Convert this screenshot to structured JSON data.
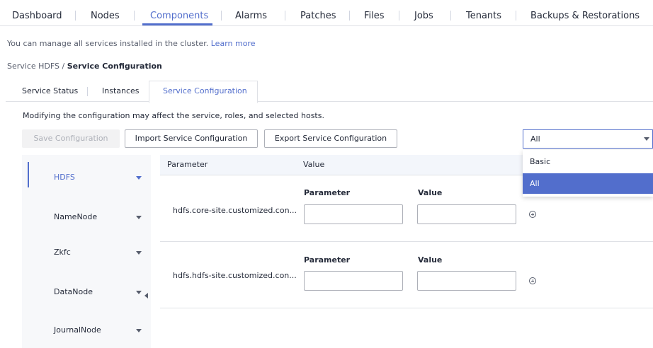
{
  "nav": {
    "tabs": [
      "Dashboard",
      "Nodes",
      "Components",
      "Alarms",
      "Patches",
      "Files",
      "Jobs",
      "Tenants",
      "Backups & Restorations"
    ],
    "active": "Components"
  },
  "info": {
    "text": "You can manage all services installed in the cluster.",
    "link": "Learn more"
  },
  "breadcrumb": {
    "parent": "Service HDFS",
    "separator": "/",
    "current": "Service Configuration"
  },
  "subtabs": [
    "Service Status",
    "Instances",
    "Service Configuration"
  ],
  "warning": "Modifying the configuration may affect the service, roles, and selected hosts.",
  "actions": {
    "save": "Save Configuration",
    "import": "Import Service Configuration",
    "export": "Export Service Configuration"
  },
  "filter": {
    "selected": "All",
    "options": [
      "Basic",
      "All"
    ]
  },
  "tree": [
    "HDFS",
    "NameNode",
    "Zkfc",
    "DataNode",
    "JournalNode"
  ],
  "table": {
    "headers": [
      "Parameter",
      "Value"
    ],
    "rows": [
      {
        "name": "hdfs.core-site.customized.con...",
        "sub_headers": [
          "Parameter",
          "Value"
        ],
        "param_value": "",
        "value_value": ""
      },
      {
        "name": "hdfs.hdfs-site.customized.con...",
        "sub_headers": [
          "Parameter",
          "Value"
        ],
        "param_value": "",
        "value_value": ""
      }
    ]
  },
  "colors": {
    "accent": "#526ecc",
    "text": "#252b3a",
    "border": "#dfe1e6",
    "header_bg": "#f3f6fb",
    "tree_bg": "#f7f8fa"
  }
}
